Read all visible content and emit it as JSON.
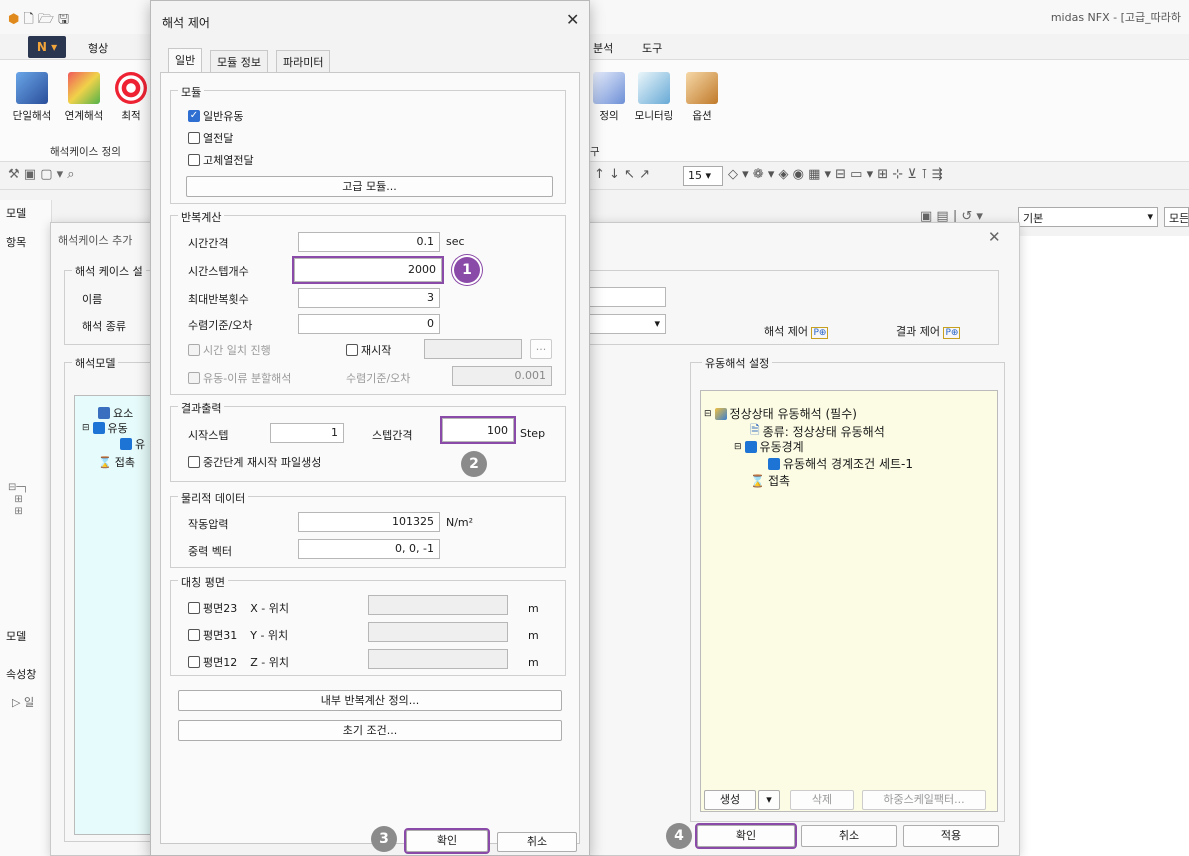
{
  "app": {
    "title": "midas NFX - [고급_따라하",
    "ribbon_tabs": [
      "형상",
      "분석",
      "도구"
    ],
    "ribbon_buttons": [
      "단일해석",
      "연계해석",
      "최적",
      "정의",
      "모니터링",
      "옵션"
    ],
    "ribbon_group_labels": [
      "해석케이스 정의",
      "구"
    ],
    "toolbar_zoom": "15",
    "left_panel": {
      "model_label": "모델",
      "item_label": "항목",
      "model_tab": "모델",
      "properties": "속성창",
      "general": "일"
    },
    "view_combo_1": "기본",
    "view_combo_2": "모든"
  },
  "case_dialog": {
    "title": "해석케이스 추가",
    "case_group": "해석 케이스 설",
    "name_label": "이름",
    "type_label": "해석 종류",
    "model_group": "해석모델",
    "analysis_control_btn": "해석 제어",
    "result_control_btn": "결과 제어",
    "flow_settings_group": "유동해석 설정",
    "left_tree": [
      "요소",
      "유동",
      "유",
      "접촉"
    ],
    "right_tree": {
      "root": "정상상태 유동해석 (필수)",
      "type": "종류: 정상상태 유동해석",
      "boundary": "유동경계",
      "boundary_set": "유동해석 경계조건 세트-1",
      "contact": "접촉"
    },
    "create_btn": "생성",
    "delete_btn": "삭제",
    "load_scale_btn": "하중스케일팩터...",
    "ok_btn": "확인",
    "cancel_btn": "취소",
    "apply_btn": "적용"
  },
  "control_dialog": {
    "title": "해석 제어",
    "tabs": [
      "일반",
      "모듈 정보",
      "파라미터"
    ],
    "module": {
      "caption": "모듈",
      "general_flow": "일반유동",
      "heat_transfer": "열전달",
      "solid_heat_transfer": "고체열전달",
      "advanced_btn": "고급 모듈..."
    },
    "iteration": {
      "caption": "반복계산",
      "time_step_label": "시간간격",
      "time_step_value": "0.1",
      "time_step_unit": "sec",
      "num_steps_label": "시간스텝개수",
      "num_steps_value": "2000",
      "max_iter_label": "최대반복횟수",
      "max_iter_value": "3",
      "convergence_label": "수렴기준/오차",
      "convergence_value": "0",
      "time_sync": "시간 일치 진행",
      "restart": "재시작",
      "browse": "...",
      "fsi": "유동-이류 분할해석",
      "fsi_conv_label": "수렴기준/오차",
      "fsi_conv_value": "0.001"
    },
    "output": {
      "caption": "결과출력",
      "start_step_label": "시작스텝",
      "start_step_value": "1",
      "step_interval_label": "스텝간격",
      "step_interval_value": "100",
      "step_unit": "Step",
      "intermediate_restart": "중간단계 재시작 파일생성"
    },
    "physics": {
      "caption": "물리적 데이터",
      "pressure_label": "작동압력",
      "pressure_value": "101325",
      "pressure_unit": "N/m²",
      "gravity_label": "중력 벡터",
      "gravity_value": "0, 0, -1"
    },
    "symmetry": {
      "caption": "대칭 평면",
      "planes": [
        {
          "label": "평면23",
          "axis": "X - 위치",
          "unit": "m"
        },
        {
          "label": "평면31",
          "axis": "Y - 위치",
          "unit": "m"
        },
        {
          "label": "평면12",
          "axis": "Z - 위치",
          "unit": "m"
        }
      ]
    },
    "inner_iter_btn": "내부 반복계산 정의...",
    "initial_cond_btn": "초기 조건...",
    "ok_btn": "확인",
    "cancel_btn": "취소"
  },
  "callouts": [
    "1",
    "2",
    "3",
    "4"
  ],
  "colors": {
    "highlight": "#8a4aa7",
    "cyan_panel": "#e6fbfb",
    "yellow_panel": "#fcfce4",
    "check_blue": "#2e6fd1"
  }
}
